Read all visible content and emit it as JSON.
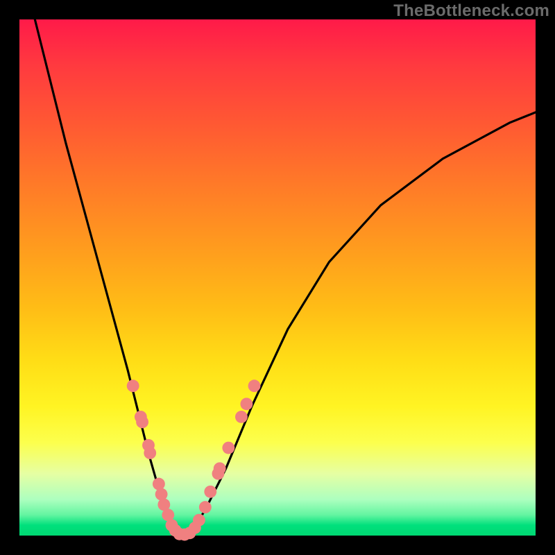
{
  "watermark": "TheBottleneck.com",
  "chart_data": {
    "type": "line",
    "title": "",
    "xlabel": "",
    "ylabel": "",
    "xlim": [
      0,
      100
    ],
    "ylim": [
      0,
      100
    ],
    "grid": false,
    "legend": false,
    "series": [
      {
        "name": "curve",
        "color": "#000000",
        "x": [
          3,
          6,
          9,
          12,
          15,
          18,
          21,
          23,
          25,
          27,
          28.5,
          30,
          31.5,
          33.5,
          36,
          40,
          45,
          52,
          60,
          70,
          82,
          95,
          100
        ],
        "y": [
          100,
          88,
          76,
          65,
          54,
          43,
          32,
          24,
          16,
          9,
          4,
          1,
          0,
          1,
          5,
          13,
          25,
          40,
          53,
          64,
          73,
          80,
          82
        ]
      }
    ],
    "markers": [
      {
        "name": "dots",
        "color": "#f08080",
        "radius_rel": 0.012,
        "points": [
          {
            "x": 22.0,
            "y": 29.0
          },
          {
            "x": 23.5,
            "y": 23.0
          },
          {
            "x": 23.8,
            "y": 22.0
          },
          {
            "x": 25.0,
            "y": 17.5
          },
          {
            "x": 25.3,
            "y": 16.0
          },
          {
            "x": 27.0,
            "y": 10.0
          },
          {
            "x": 27.5,
            "y": 8.0
          },
          {
            "x": 28.0,
            "y": 6.0
          },
          {
            "x": 28.8,
            "y": 4.0
          },
          {
            "x": 29.5,
            "y": 2.0
          },
          {
            "x": 30.2,
            "y": 1.0
          },
          {
            "x": 31.0,
            "y": 0.3
          },
          {
            "x": 32.0,
            "y": 0.2
          },
          {
            "x": 33.0,
            "y": 0.5
          },
          {
            "x": 34.0,
            "y": 1.5
          },
          {
            "x": 34.8,
            "y": 3.0
          },
          {
            "x": 36.0,
            "y": 5.5
          },
          {
            "x": 37.0,
            "y": 8.5
          },
          {
            "x": 38.5,
            "y": 12.0
          },
          {
            "x": 38.8,
            "y": 13.0
          },
          {
            "x": 40.5,
            "y": 17.0
          },
          {
            "x": 43.0,
            "y": 23.0
          },
          {
            "x": 44.0,
            "y": 25.5
          },
          {
            "x": 45.5,
            "y": 29.0
          }
        ]
      }
    ]
  }
}
